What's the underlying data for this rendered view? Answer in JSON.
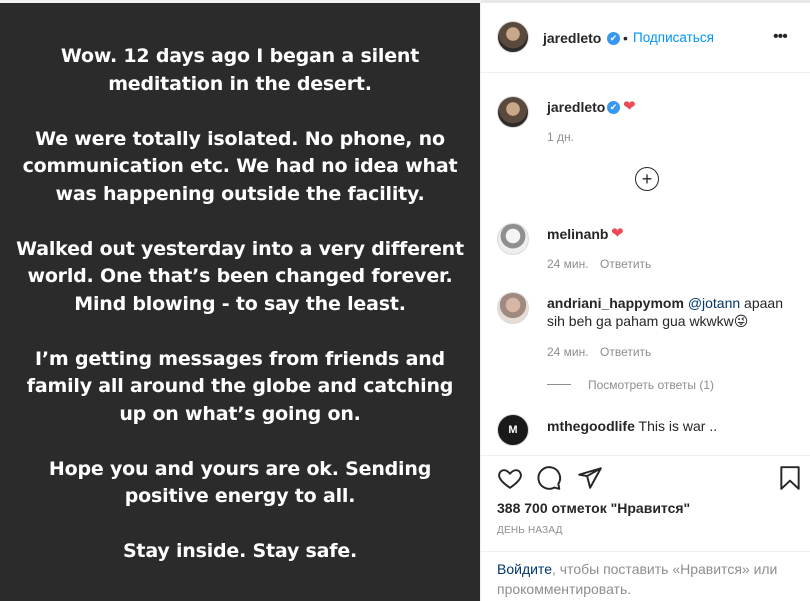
{
  "post": {
    "paragraphs": [
      [
        "Wow. 12 days ago I began a silent",
        "meditation in the desert."
      ],
      [
        "We were totally isolated. No phone, no",
        "communication etc. We had no idea what",
        "was happening outside the facility."
      ],
      [
        "Walked out yesterday into a very different",
        "world. One that’s been changed forever.",
        "Mind blowing - to say the least."
      ],
      [
        "I’m getting messages from friends and",
        "family all around the globe and catching",
        "up on what’s going on."
      ],
      [
        "Hope you and yours are ok. Sending",
        "positive energy to all."
      ],
      [
        "Stay inside. Stay safe."
      ]
    ]
  },
  "header": {
    "username": "jaredleto",
    "verified": "✔",
    "separator": "•",
    "follow_label": "Подписаться",
    "more_icon": "•••"
  },
  "caption": {
    "username": "jaredleto",
    "verified": "✔",
    "heart": "❤",
    "time": "1 дн."
  },
  "load_more_icon": "+",
  "comments": [
    {
      "username": "melinanb",
      "text": "",
      "heart": "❤",
      "time": "24 мин.",
      "reply_label": "Ответить"
    },
    {
      "username": "andriani_happymom",
      "mention": "@jotann",
      "text": " apaan sih beh ga paham gua wkwkw",
      "emoji": "😜",
      "time": "24 мин.",
      "reply_label": "Ответить",
      "view_replies": "Посмотреть ответы (1)"
    },
    {
      "username": "mthegoodlife",
      "text": "This is war ..",
      "avatar_letter": "M"
    }
  ],
  "actions": {
    "likes": "388 700 отметок \"Нравится\"",
    "time": "ДЕНЬ НАЗАД"
  },
  "login": {
    "link": "Войдите",
    "text": ", чтобы поставить «Нравится» или прокомментировать."
  },
  "colors": {
    "accent": "#0095f6",
    "heart": "#ed4956",
    "post_background": "#2b2b2b"
  }
}
